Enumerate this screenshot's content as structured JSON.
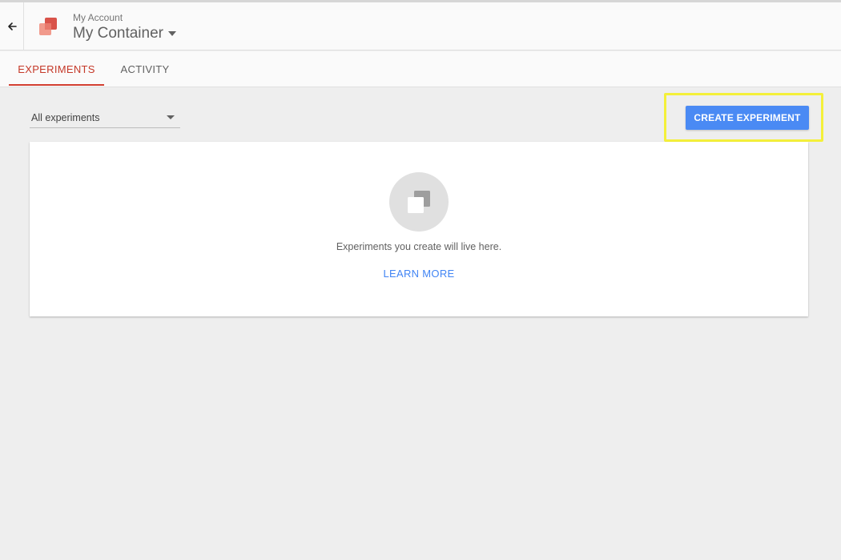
{
  "header": {
    "account": "My Account",
    "container": "My Container"
  },
  "tabs": [
    {
      "label": "EXPERIMENTS",
      "active": true
    },
    {
      "label": "ACTIVITY",
      "active": false
    }
  ],
  "filter": {
    "selected": "All experiments"
  },
  "toolbar": {
    "create_label": "CREATE EXPERIMENT"
  },
  "empty_state": {
    "message": "Experiments you create will live here.",
    "link_label": "LEARN MORE"
  },
  "icons": {
    "back": "arrow-back-icon",
    "logo": "optimize-logo-icon",
    "dropdown": "caret-down-icon",
    "empty": "experiment-squares-icon"
  },
  "colors": {
    "accent_tab": "#c53929",
    "primary_button": "#4a8af4",
    "link": "#4285f4",
    "highlight": "#f4f03a",
    "logo_dark": "#d9534a",
    "logo_light": "#f19a8c"
  }
}
